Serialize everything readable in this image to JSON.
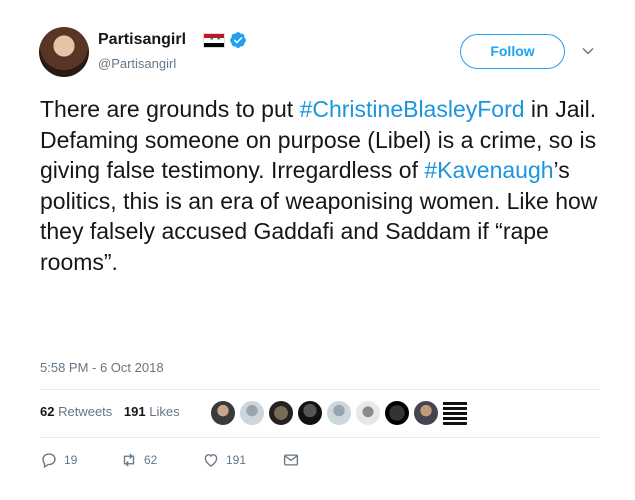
{
  "author": {
    "display_name": "Partisangirl",
    "handle": "@Partisangirl",
    "flag": "syria-flag-icon",
    "verified_icon": "verified-badge-icon"
  },
  "follow_label": "Follow",
  "tweet": {
    "seg1": "There are grounds to put ",
    "hashtag1": "#ChristineBlasleyFord",
    "seg2": " in Jail. Defaming someone on purpose (Libel) is a crime, so is giving false testimony. Irregardless of ",
    "hashtag2": "#Kavenaugh",
    "seg3": "’s politics, this is an era of weaponising women. Like how they falsely accused Gaddafi and Saddam if “rape rooms”."
  },
  "timestamp": "5:58 PM - 6 Oct 2018",
  "stats": {
    "retweets_count": "62",
    "retweets_label": "Retweets",
    "likes_count": "191",
    "likes_label": "Likes"
  },
  "actions": {
    "reply_count": "19",
    "retweet_count": "62",
    "like_count": "191"
  },
  "colors": {
    "accent": "#1da1f2",
    "hashtag": "#1b95e0",
    "muted": "#657786"
  }
}
